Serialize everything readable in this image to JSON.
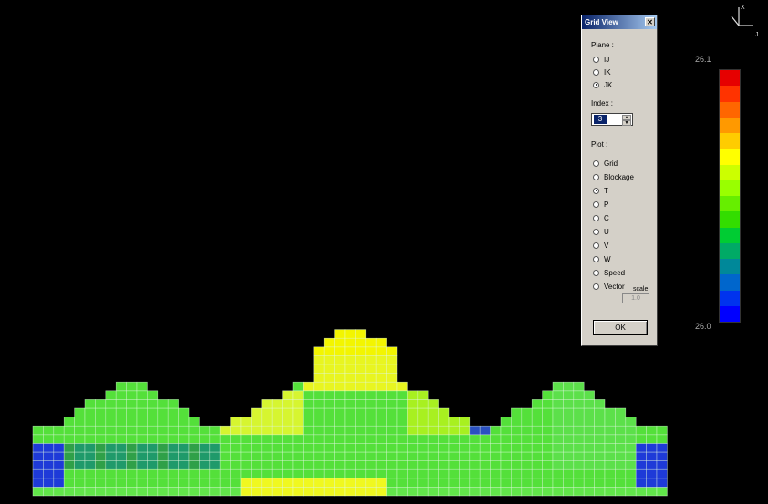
{
  "dialog": {
    "title": "Grid View",
    "close_label": "✕",
    "plane_label": "Plane :",
    "plane_options": [
      "IJ",
      "IK",
      "JK"
    ],
    "plane_selected": "JK",
    "index_label": "Index :",
    "index_value": "3",
    "plot_label": "Plot :",
    "plot_options": [
      "Grid",
      "Blockage",
      "T",
      "P",
      "C",
      "U",
      "V",
      "W",
      "Speed",
      "Vector"
    ],
    "plot_selected": "T",
    "scale_label": "scale",
    "scale_value": "1.0",
    "ok_label": "OK"
  },
  "legend": {
    "max_label": "26.1",
    "min_label": "26.0",
    "colors": [
      "#e60000",
      "#ff3300",
      "#ff6600",
      "#ff9900",
      "#ffcc00",
      "#ffff00",
      "#ccff00",
      "#99ff00",
      "#66ee00",
      "#33dd00",
      "#00cc33",
      "#00aa66",
      "#008899",
      "#0066cc",
      "#0033ee",
      "#0000ff"
    ]
  },
  "axis_triad": {
    "labels": [
      "X",
      "J"
    ]
  },
  "field": {
    "variable": "T",
    "min": 26.0,
    "max": 26.1
  }
}
